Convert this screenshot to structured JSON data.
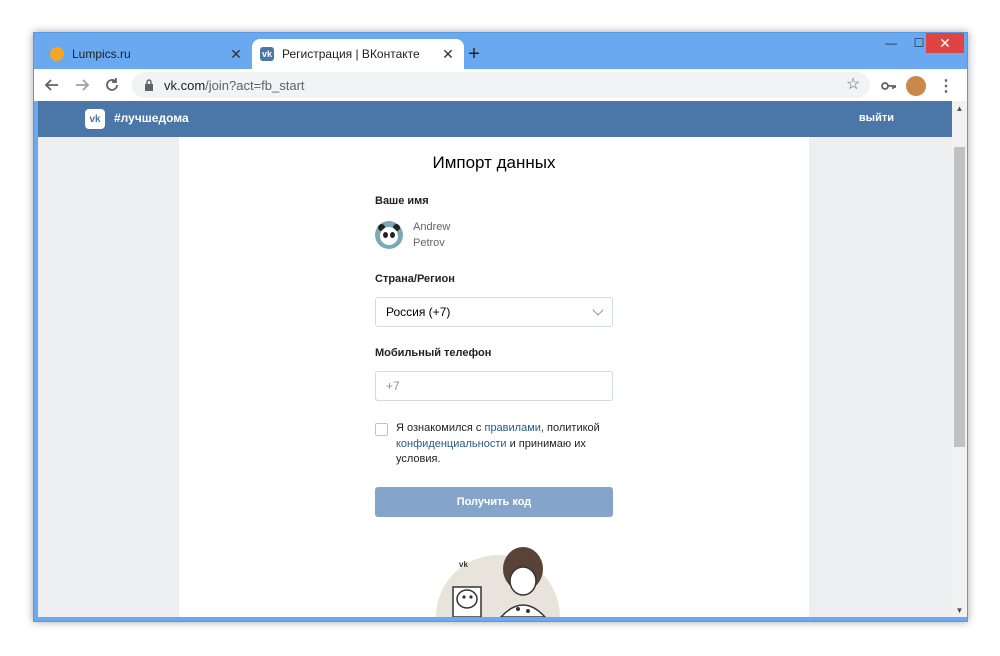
{
  "browser": {
    "tabs": [
      {
        "title": "Lumpics.ru",
        "favicon": "lumpics-orange-icon",
        "close": "✕"
      },
      {
        "title": "Регистрация | ВКонтакте",
        "favicon": "vk-icon",
        "close": "✕"
      }
    ],
    "new_tab": "+",
    "window_controls": {
      "minimize": "—",
      "maximize": "☐",
      "close": "✕"
    },
    "address": {
      "host": "vk.com",
      "path": "/join?act=fb_start"
    }
  },
  "vk_header": {
    "logo": "vk",
    "hashtag": "#лучшедома",
    "logout": "выйти"
  },
  "form": {
    "title": "Импорт данных",
    "name_label": "Ваше имя",
    "first_name": "Andrew",
    "last_name": "Petrov",
    "country_label": "Страна/Регион",
    "country_value": "Россия (+7)",
    "phone_label": "Мобильный телефон",
    "phone_placeholder": "+7",
    "agree": {
      "part1": "Я ознакомился с ",
      "rules_link": "правилами",
      "part2": ", политикой ",
      "privacy_link": "конфиденциальности",
      "part3": " и принимаю их условия."
    },
    "submit": "Получить код"
  },
  "colors": {
    "vk_blue": "#4a76a8",
    "button_disabled": "#84a5c9",
    "link": "#2a5885",
    "page_bg": "#edeef0",
    "window_frame": "#6aa9f0"
  }
}
